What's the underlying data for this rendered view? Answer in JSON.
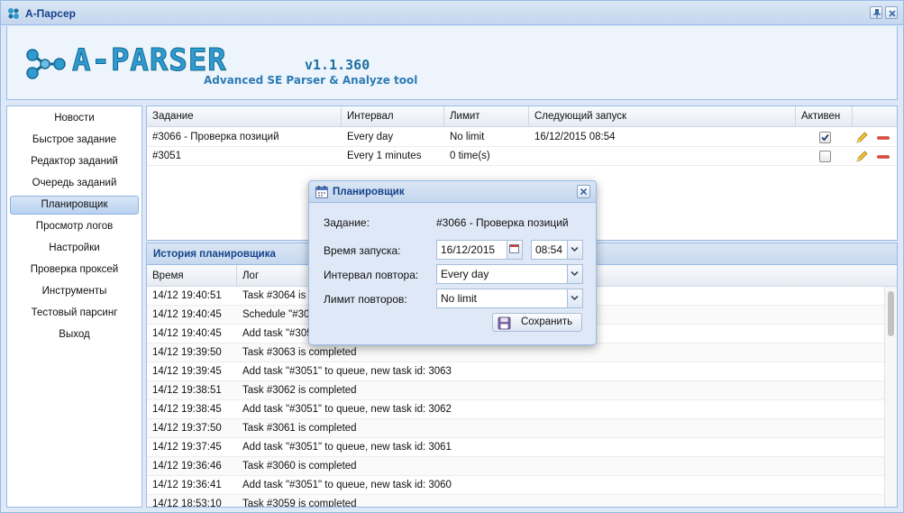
{
  "window": {
    "title": "А-Парсер"
  },
  "banner": {
    "logo_text": "A-PARSER",
    "version": "v1.1.360",
    "tagline": "Advanced SE Parser & Analyze tool"
  },
  "sidebar": {
    "items": [
      {
        "label": "Новости"
      },
      {
        "label": "Быстрое задание"
      },
      {
        "label": "Редактор заданий"
      },
      {
        "label": "Очередь заданий"
      },
      {
        "label": "Планировщик",
        "active": true
      },
      {
        "label": "Просмотр логов"
      },
      {
        "label": "Настройки"
      },
      {
        "label": "Проверка проксей"
      },
      {
        "label": "Инструменты"
      },
      {
        "label": "Тестовый парсинг"
      },
      {
        "label": "Выход"
      }
    ]
  },
  "tasks": {
    "columns": [
      "Задание",
      "Интервал",
      "Лимит",
      "Следующий запуск",
      "Активен"
    ],
    "rows": [
      {
        "task": "#3066 - Проверка позиций",
        "interval": "Every day",
        "limit": "No limit",
        "next_run": "16/12/2015 08:54",
        "active": true
      },
      {
        "task": "#3051",
        "interval": "Every 1 minutes",
        "limit": "0 time(s)",
        "next_run": "",
        "active": false
      }
    ]
  },
  "history": {
    "title": "История планировщика",
    "columns": [
      "Время",
      "Лог"
    ],
    "rows": [
      {
        "time": "14/12 19:40:51",
        "log": "Task #3064 is completed"
      },
      {
        "time": "14/12 19:40:45",
        "log": "Schedule \"#3051\" is executed"
      },
      {
        "time": "14/12 19:40:45",
        "log": "Add task \"#3051\" to queue, new task id: 3064"
      },
      {
        "time": "14/12 19:39:50",
        "log": "Task #3063 is completed"
      },
      {
        "time": "14/12 19:39:45",
        "log": "Add task \"#3051\" to queue, new task id: 3063"
      },
      {
        "time": "14/12 19:38:51",
        "log": "Task #3062 is completed"
      },
      {
        "time": "14/12 19:38:45",
        "log": "Add task \"#3051\" to queue, new task id: 3062"
      },
      {
        "time": "14/12 19:37:50",
        "log": "Task #3061 is completed"
      },
      {
        "time": "14/12 19:37:45",
        "log": "Add task \"#3051\" to queue, new task id: 3061"
      },
      {
        "time": "14/12 19:36:46",
        "log": "Task #3060 is completed"
      },
      {
        "time": "14/12 19:36:41",
        "log": "Add task \"#3051\" to queue, new task id: 3060"
      },
      {
        "time": "14/12 18:53:10",
        "log": "Task #3059 is completed"
      }
    ]
  },
  "dialog": {
    "title": "Планировщик",
    "task_label": "Задание:",
    "task_value": "#3066 - Проверка позиций",
    "start_label": "Время запуска:",
    "start_date": "16/12/2015",
    "start_time": "08:54",
    "interval_label": "Интервал повтора:",
    "interval_value": "Every day",
    "limit_label": "Лимит повторов:",
    "limit_value": "No limit",
    "save_label": "Сохранить"
  },
  "colors": {
    "accent": "#15428b",
    "panel_border": "#99bbe8",
    "background": "#dfe8f6"
  }
}
